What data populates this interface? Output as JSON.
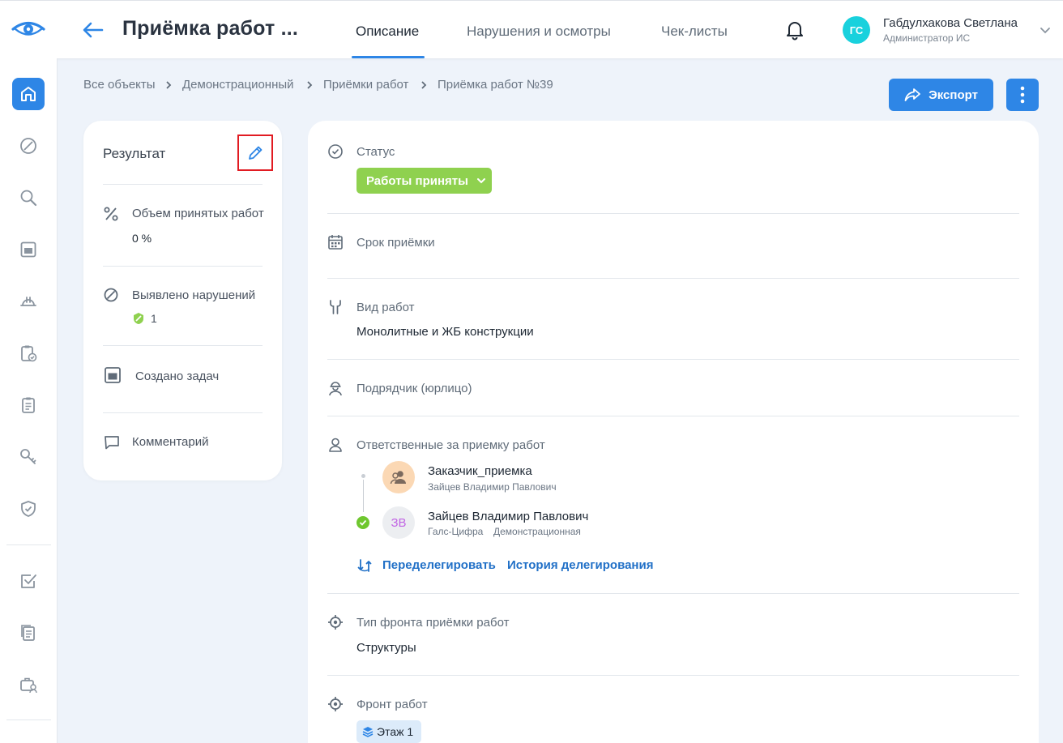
{
  "header": {
    "title": "Приёмка работ ...",
    "tabs": [
      {
        "label": "Описание",
        "active": true
      },
      {
        "label": "Нарушения и осмотры",
        "active": false
      },
      {
        "label": "Чек-листы",
        "active": false
      }
    ],
    "user": {
      "initials": "ГС",
      "name": "Габдулхакова Светлана",
      "role": "Администратор ИС"
    }
  },
  "breadcrumb": [
    "Все объекты",
    "Демонстрационный",
    "Приёмки работ",
    "Приёмка работ №39"
  ],
  "toolbar": {
    "export_label": "Экспорт"
  },
  "sidebar": {
    "items": [
      "home-icon",
      "prohibited-icon",
      "search-icon",
      "calendar-icon",
      "helmet-icon",
      "clipboard-check-icon",
      "clipboard-list-icon",
      "key-icon",
      "shield-icon",
      "checkbox-icon",
      "documents-icon",
      "briefcase-user-icon"
    ]
  },
  "result": {
    "title": "Результат",
    "volume_label": "Объем принятых работ",
    "volume_value": "0 %",
    "violations_label": "Выявлено нарушений",
    "violations_count": "1",
    "tasks_label": "Создано задач",
    "comment_label": "Комментарий"
  },
  "details": {
    "status_label": "Статус",
    "status_value": "Работы приняты",
    "deadline_label": "Срок приёмки",
    "work_type_label": "Вид работ",
    "work_type_value": "Монолитные и ЖБ конструкции",
    "contractor_label": "Подрядчик (юрлицо)",
    "responsible_label": "Ответственные за приемку работ",
    "persons": [
      {
        "name": "Заказчик_приемка",
        "sub": "Зайцев Владимир Павлович"
      },
      {
        "initials": "ЗВ",
        "name": "Зайцев Владимир Павлович",
        "org": "Галс-Цифра",
        "project": "Демонстрационная"
      }
    ],
    "redelegate_label": "Переделегировать",
    "history_label": "История делегирования",
    "front_type_label": "Тип фронта приёмки работ",
    "front_type_value": "Структуры",
    "front_label": "Фронт работ",
    "front_chip": "Этаж 1"
  },
  "colors": {
    "accent": "#2e86e6",
    "status_green": "#8fd14f",
    "edit_highlight": "#e11b22",
    "avatar_cyan": "#19d1dd"
  }
}
